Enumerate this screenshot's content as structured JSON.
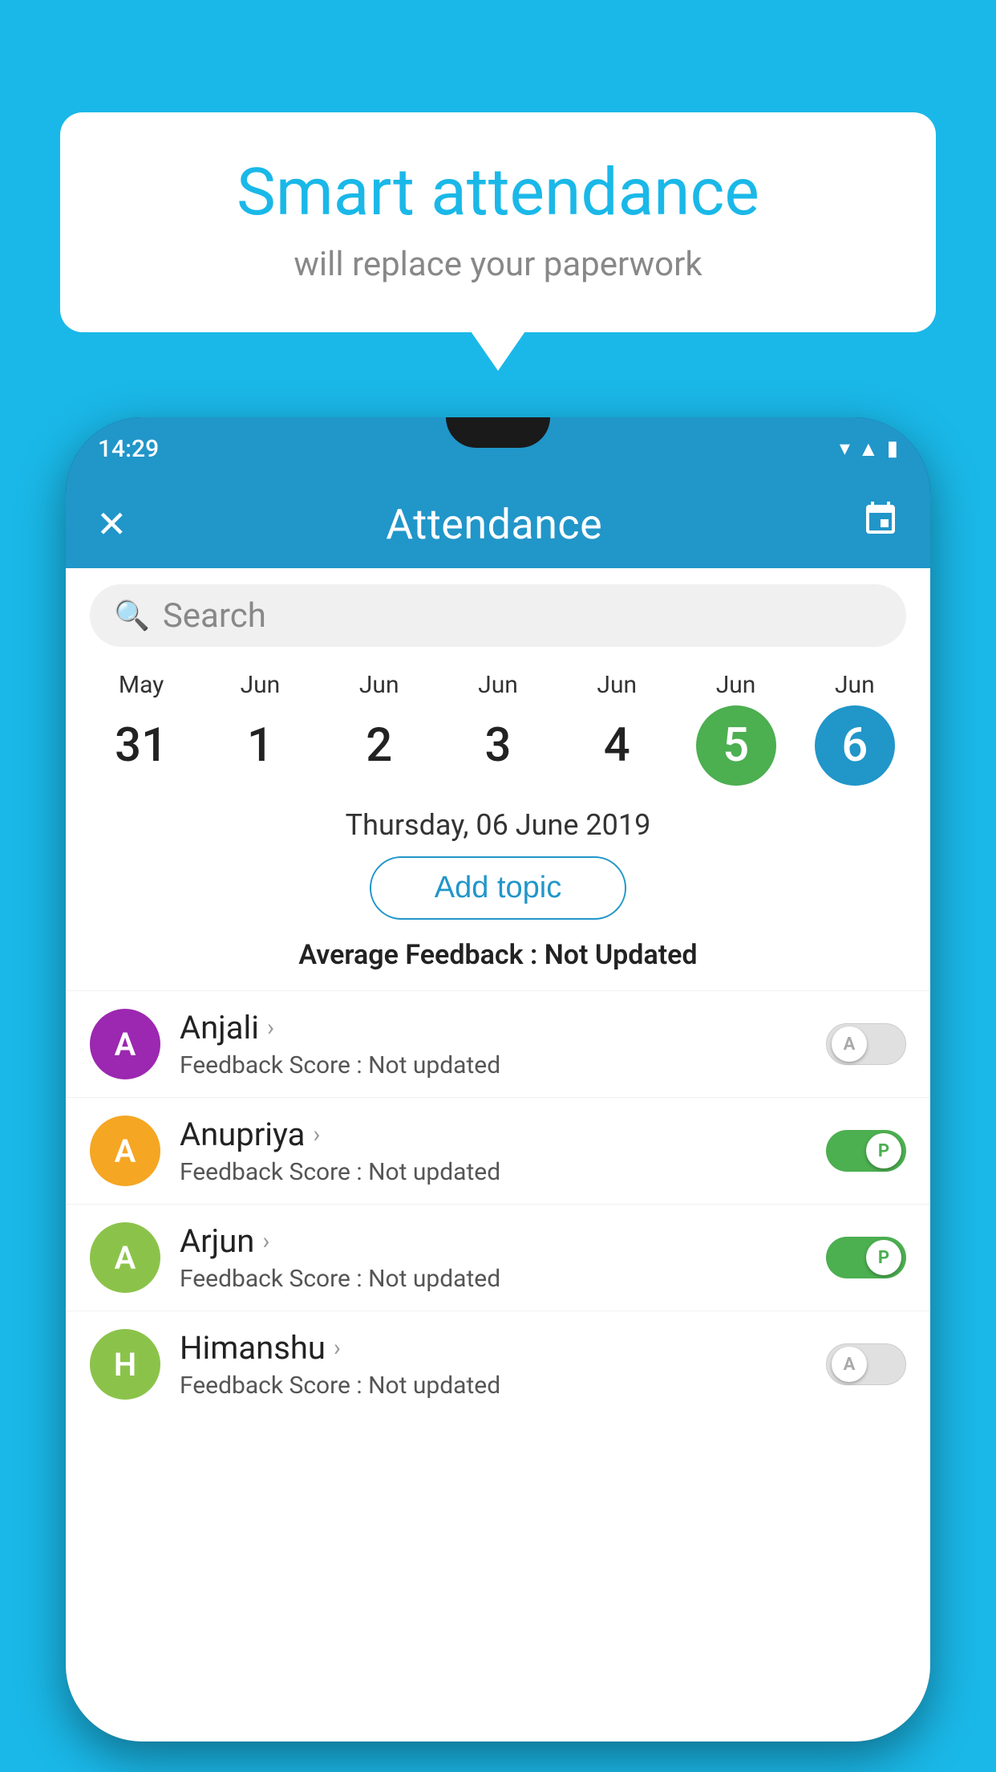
{
  "background_color": "#1ab8e8",
  "speech_bubble": {
    "title": "Smart attendance",
    "subtitle": "will replace your paperwork"
  },
  "phone": {
    "status_bar": {
      "time": "14:29",
      "icons": [
        "wifi",
        "signal",
        "battery"
      ]
    },
    "app_bar": {
      "close_icon": "✕",
      "title": "Attendance",
      "calendar_icon": "📅"
    },
    "search": {
      "placeholder": "Search"
    },
    "calendar": {
      "days": [
        {
          "month": "May",
          "date": "31",
          "type": "normal"
        },
        {
          "month": "Jun",
          "date": "1",
          "type": "normal"
        },
        {
          "month": "Jun",
          "date": "2",
          "type": "normal"
        },
        {
          "month": "Jun",
          "date": "3",
          "type": "normal"
        },
        {
          "month": "Jun",
          "date": "4",
          "type": "normal"
        },
        {
          "month": "Jun",
          "date": "5",
          "type": "today"
        },
        {
          "month": "Jun",
          "date": "6",
          "type": "selected"
        }
      ]
    },
    "selected_date": "Thursday, 06 June 2019",
    "add_topic_label": "Add topic",
    "avg_feedback_label": "Average Feedback :",
    "avg_feedback_value": "Not Updated",
    "students": [
      {
        "name": "Anjali",
        "avatar_letter": "A",
        "avatar_color": "purple",
        "feedback_label": "Feedback Score :",
        "feedback_value": "Not updated",
        "toggle_state": "off",
        "toggle_label": "A"
      },
      {
        "name": "Anupriya",
        "avatar_letter": "A",
        "avatar_color": "yellow",
        "feedback_label": "Feedback Score :",
        "feedback_value": "Not updated",
        "toggle_state": "on",
        "toggle_label": "P"
      },
      {
        "name": "Arjun",
        "avatar_letter": "A",
        "avatar_color": "green",
        "feedback_label": "Feedback Score :",
        "feedback_value": "Not updated",
        "toggle_state": "on",
        "toggle_label": "P"
      },
      {
        "name": "Himanshu",
        "avatar_letter": "H",
        "avatar_color": "green-dark",
        "feedback_label": "Feedback Score :",
        "feedback_value": "Not updated",
        "toggle_state": "off",
        "toggle_label": "A"
      }
    ]
  }
}
